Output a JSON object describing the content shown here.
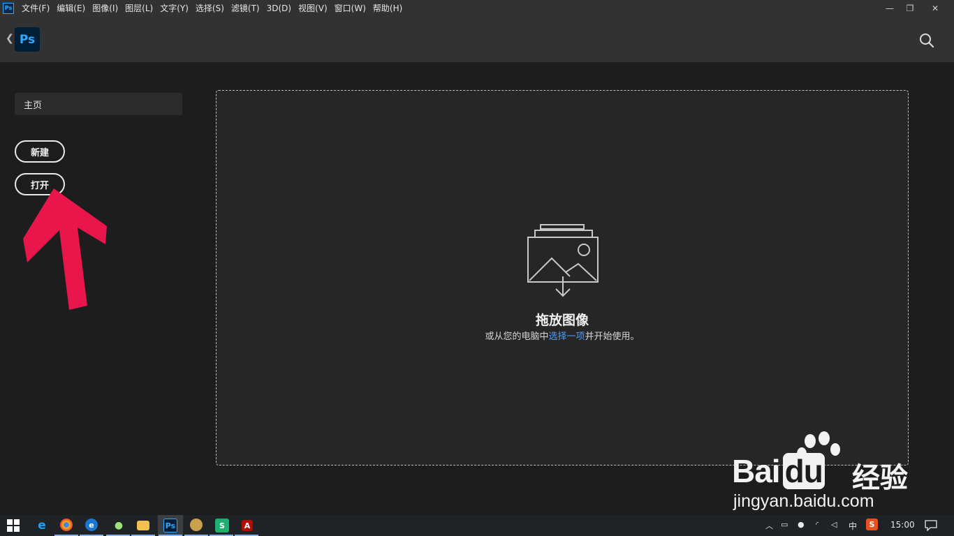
{
  "app": {
    "logo_text": "Ps",
    "mini_logo_text": "Ps"
  },
  "menu": [
    "文件(F)",
    "编辑(E)",
    "图像(I)",
    "图层(L)",
    "文字(Y)",
    "选择(S)",
    "滤镜(T)",
    "3D(D)",
    "视图(V)",
    "窗口(W)",
    "帮助(H)"
  ],
  "window_controls": {
    "minimize": "—",
    "restore": "❐",
    "close": "✕"
  },
  "sidebar": {
    "home_label": "主页",
    "new_label": "新建",
    "open_label": "打开"
  },
  "dropzone": {
    "title": "拖放图像",
    "sub_before": "或从您的电脑中",
    "sub_link": "选择一项",
    "sub_after": "并开始使用。"
  },
  "watermark": {
    "brand": "Bai",
    "brand_tail": "du",
    "jingyan": "经验",
    "url": "jingyan.baidu.com"
  },
  "taskbar": {
    "apps": [
      "start-icon",
      "ie-icon",
      "chrome-icon",
      "edge-icon",
      "wechat-icon",
      "explorer-icon",
      "photoshop-icon",
      "app-icon",
      "wps-icon",
      "acrobat-icon"
    ],
    "ime": "中",
    "clock": "15:00"
  },
  "colors": {
    "accent_blue": "#31a8ff",
    "link": "#4f9ef8",
    "arrow": "#e8164a"
  }
}
